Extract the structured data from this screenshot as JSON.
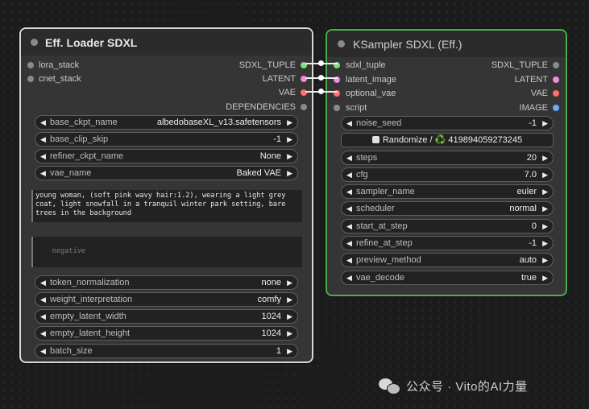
{
  "loader": {
    "title": "Eff. Loader SDXL",
    "inputs": [
      "lora_stack",
      "cnet_stack"
    ],
    "outputs": [
      {
        "label": "SDXL_TUPLE",
        "color": "#7ee27e"
      },
      {
        "label": "LATENT",
        "color": "#f08bd6"
      },
      {
        "label": "VAE",
        "color": "#ff6e6e"
      },
      {
        "label": "DEPENDENCIES",
        "color": "#8a8a8a"
      }
    ],
    "widgets_top": [
      {
        "label": "base_ckpt_name",
        "value": "albedobaseXL_v13.safetensors"
      },
      {
        "label": "base_clip_skip",
        "value": "-1"
      },
      {
        "label": "refiner_ckpt_name",
        "value": "None"
      },
      {
        "label": "vae_name",
        "value": "Baked VAE"
      }
    ],
    "positive_text": "young woman, (soft pink wavy hair:1.2), wearing a light grey coat, light snowfall in a tranquil winter park setting, bare trees in the background",
    "negative_placeholder": "negative",
    "widgets_bottom": [
      {
        "label": "token_normalization",
        "value": "none"
      },
      {
        "label": "weight_interpretation",
        "value": "comfy"
      },
      {
        "label": "empty_latent_width",
        "value": "1024"
      },
      {
        "label": "empty_latent_height",
        "value": "1024"
      },
      {
        "label": "batch_size",
        "value": "1"
      }
    ]
  },
  "ksampler": {
    "title": "KSampler SDXL (Eff.)",
    "slots": [
      {
        "in": "sdxl_tuple",
        "in_color": "#7ee27e",
        "out": "SDXL_TUPLE",
        "out_color": "#8a8a8a"
      },
      {
        "in": "latent_image",
        "in_color": "#f08bd6",
        "out": "LATENT",
        "out_color": "#f08bd6"
      },
      {
        "in": "optional_vae",
        "in_color": "#ff6e6e",
        "out": "VAE",
        "out_color": "#ff6e6e"
      },
      {
        "in": "script",
        "in_color": "#8a8a8a",
        "out": "IMAGE",
        "out_color": "#6fa8ff"
      }
    ],
    "noise_seed": {
      "label": "noise_seed",
      "value": "-1"
    },
    "randomize_label": "Randomize / ♻️ 419894059273245",
    "widgets": [
      {
        "label": "steps",
        "value": "20"
      },
      {
        "label": "cfg",
        "value": "7.0"
      },
      {
        "label": "sampler_name",
        "value": "euler"
      },
      {
        "label": "scheduler",
        "value": "normal"
      },
      {
        "label": "start_at_step",
        "value": "0"
      },
      {
        "label": "refine_at_step",
        "value": "-1"
      },
      {
        "label": "preview_method",
        "value": "auto"
      },
      {
        "label": "vae_decode",
        "value": "true"
      }
    ]
  },
  "watermark": "公众号 · Vito的AI力量"
}
